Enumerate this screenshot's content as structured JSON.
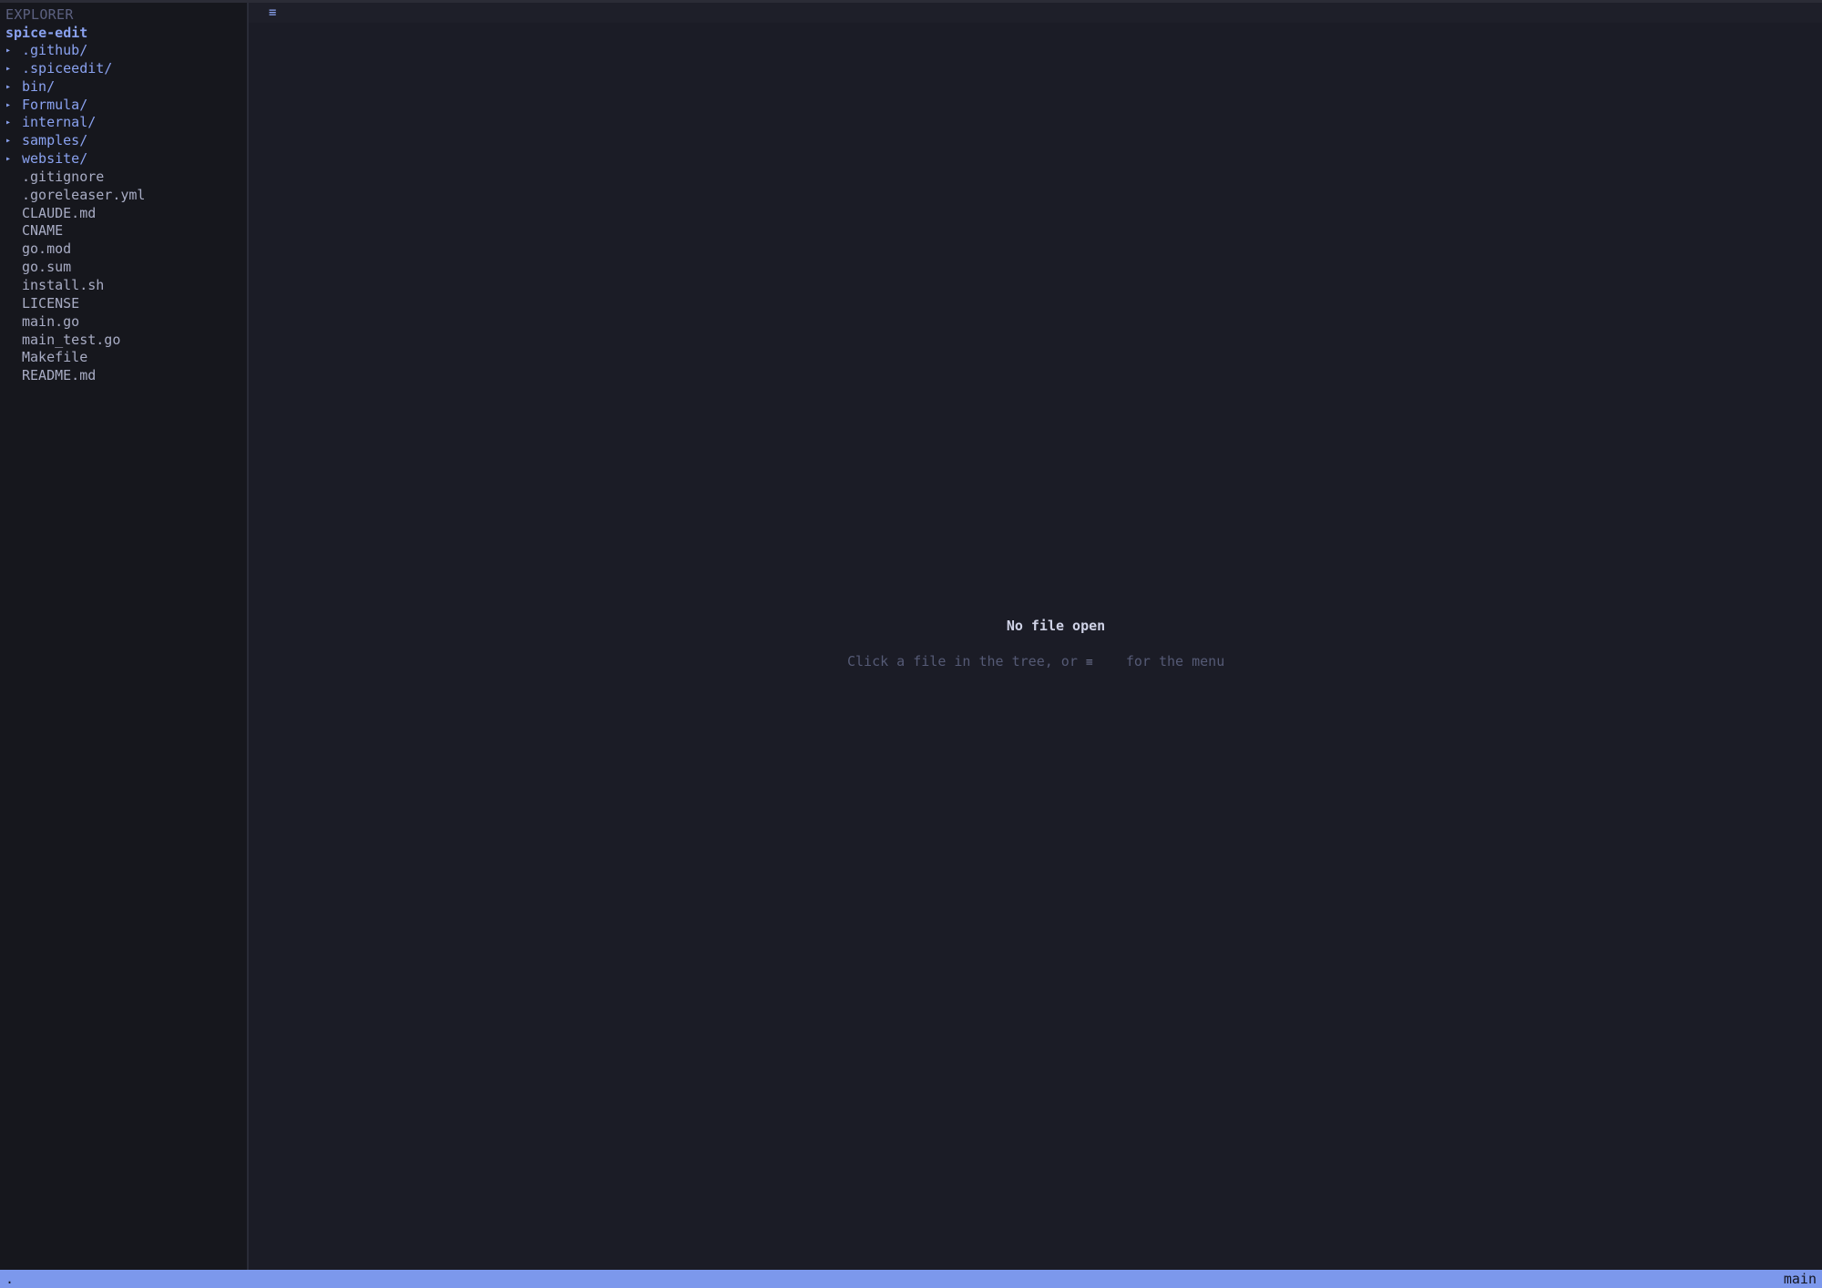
{
  "explorer": {
    "header": "EXPLORER",
    "root": "spice-edit",
    "items": [
      {
        "name": ".github/",
        "type": "dir",
        "icon": "caret-right-icon"
      },
      {
        "name": ".spiceedit/",
        "type": "dir",
        "icon": "caret-right-icon"
      },
      {
        "name": "bin/",
        "type": "dir",
        "icon": "caret-right-icon"
      },
      {
        "name": "Formula/",
        "type": "dir",
        "icon": "caret-right-icon"
      },
      {
        "name": "internal/",
        "type": "dir",
        "icon": "caret-right-icon"
      },
      {
        "name": "samples/",
        "type": "dir",
        "icon": "caret-right-icon"
      },
      {
        "name": "website/",
        "type": "dir",
        "icon": "caret-right-icon"
      },
      {
        "name": ".gitignore",
        "type": "file"
      },
      {
        "name": ".goreleaser.yml",
        "type": "file"
      },
      {
        "name": "CLAUDE.md",
        "type": "file"
      },
      {
        "name": "CNAME",
        "type": "file"
      },
      {
        "name": "go.mod",
        "type": "file"
      },
      {
        "name": "go.sum",
        "type": "file"
      },
      {
        "name": "install.sh",
        "type": "file"
      },
      {
        "name": "LICENSE",
        "type": "file"
      },
      {
        "name": "main.go",
        "type": "file"
      },
      {
        "name": "main_test.go",
        "type": "file"
      },
      {
        "name": "Makefile",
        "type": "file"
      },
      {
        "name": "README.md",
        "type": "file"
      }
    ]
  },
  "tabbar": {
    "menu_glyph": "≡",
    "menu_icon": "hamburger-menu-icon"
  },
  "editor": {
    "empty_title": "No file open",
    "empty_hint_before": "Click a file in the tree, or ",
    "empty_hint_glyph": "≡",
    "empty_hint_after": "    for the menu"
  },
  "statusbar": {
    "left": ".",
    "right": "main"
  },
  "colors": {
    "accent": "#8aa2f0",
    "statusbar": "#7c98ec",
    "sidebar_bg": "#16171d",
    "editor_bg": "#1b1c26"
  }
}
